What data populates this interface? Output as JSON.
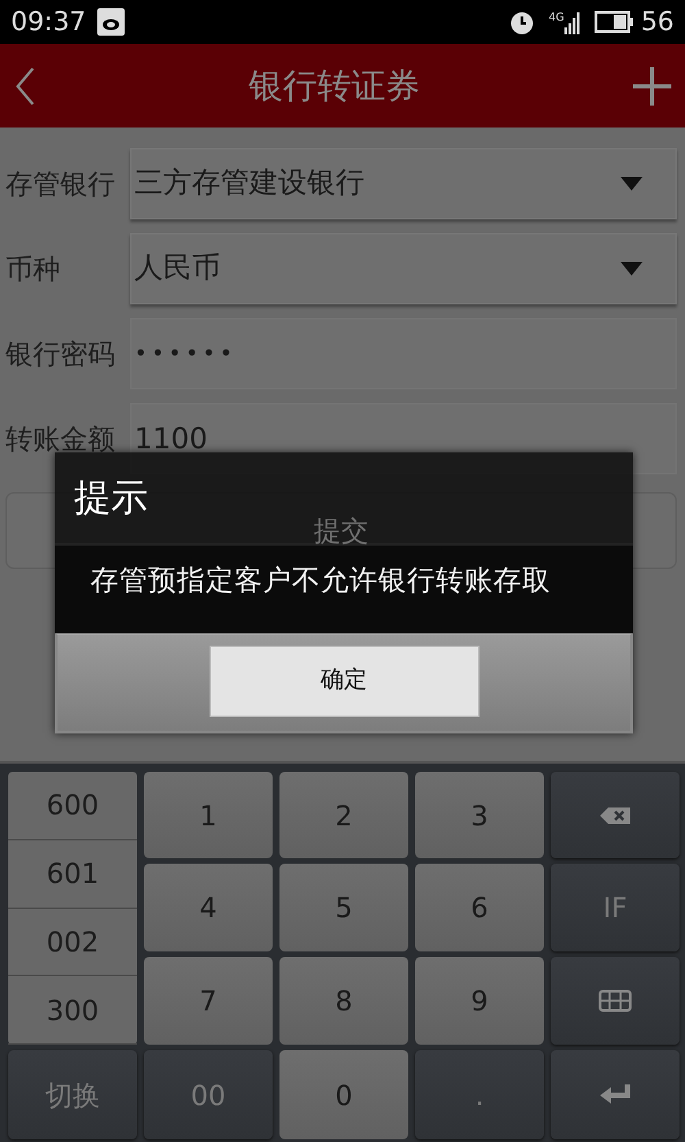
{
  "status_bar": {
    "time": "09:37",
    "network": "4G",
    "battery": "56"
  },
  "header": {
    "title": "银行转证券"
  },
  "form": {
    "fields": [
      {
        "label": "存管银行",
        "kind": "select",
        "value": "三方存管建设银行"
      },
      {
        "label": "币种",
        "kind": "select",
        "value": "人民币"
      },
      {
        "label": "银行密码",
        "kind": "password",
        "value": "••••••"
      },
      {
        "label": "转账金额",
        "kind": "text",
        "value": "1100"
      }
    ],
    "submit": "提交"
  },
  "dialog": {
    "title": "提示",
    "message": "存管预指定客户不允许银行转账存取",
    "button": "确定"
  },
  "keyboard": {
    "shortcuts": [
      "600",
      "601",
      "002",
      "300"
    ],
    "rows": [
      [
        {
          "kind": "span"
        },
        {
          "label": "1",
          "kind": "light"
        },
        {
          "label": "2",
          "kind": "light"
        },
        {
          "label": "3",
          "kind": "light"
        },
        {
          "kind": "backspace"
        }
      ],
      [
        {
          "kind": "span"
        },
        {
          "label": "4",
          "kind": "light"
        },
        {
          "label": "5",
          "kind": "light"
        },
        {
          "label": "6",
          "kind": "light"
        },
        {
          "label": "IF",
          "kind": "dark"
        }
      ],
      [
        {
          "kind": "span"
        },
        {
          "label": "7",
          "kind": "light"
        },
        {
          "label": "8",
          "kind": "light"
        },
        {
          "label": "9",
          "kind": "light"
        },
        {
          "kind": "hide"
        }
      ],
      [
        {
          "label": "切换",
          "kind": "dark"
        },
        {
          "label": "00",
          "kind": "dark"
        },
        {
          "label": "0",
          "kind": "light"
        },
        {
          "label": ".",
          "kind": "dark"
        },
        {
          "kind": "enter"
        }
      ]
    ]
  }
}
